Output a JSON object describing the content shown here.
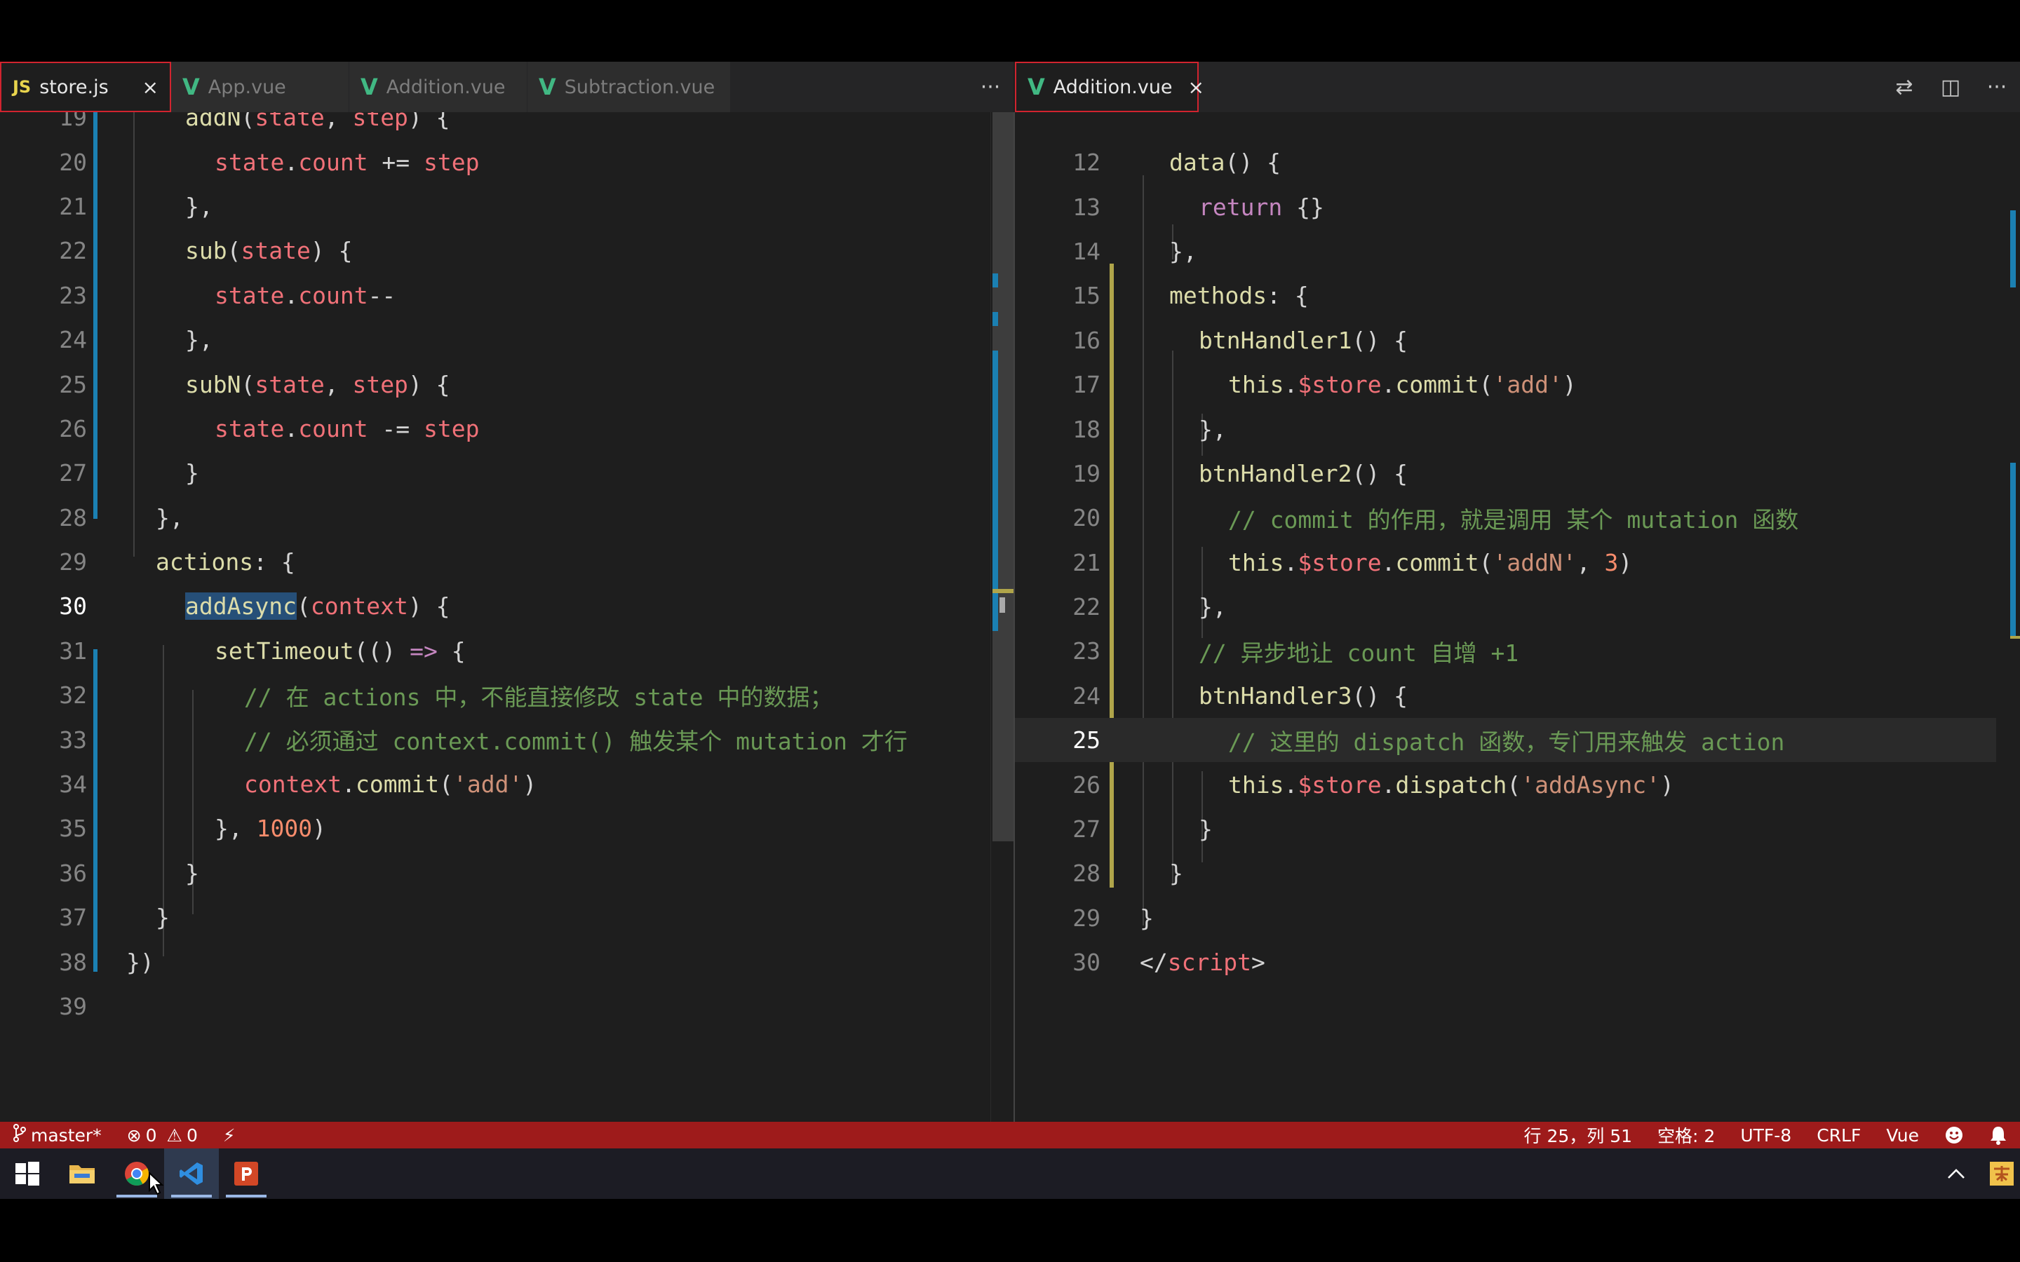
{
  "left_tabs": [
    {
      "icon": "js-file-icon",
      "badge": "JS",
      "label": "store.js",
      "active": true,
      "close": "×"
    },
    {
      "icon": "vue-file-icon",
      "badge": "V",
      "label": "App.vue",
      "active": false
    },
    {
      "icon": "vue-file-icon",
      "badge": "V",
      "label": "Addition.vue",
      "active": false
    },
    {
      "icon": "vue-file-icon",
      "badge": "V",
      "label": "Subtraction.vue",
      "active": false
    }
  ],
  "right_tabs": [
    {
      "icon": "vue-file-icon",
      "badge": "V",
      "label": "Addition.vue",
      "active": true,
      "close": "×"
    }
  ],
  "actions": {
    "more": "···",
    "compare": "⇄",
    "split": "◫"
  },
  "left_code": [
    {
      "n": "19",
      "indent": 2,
      "tokens": [
        [
          "func",
          "addN"
        ],
        [
          "punct",
          "("
        ],
        [
          "var",
          "state"
        ],
        [
          "punct",
          ", "
        ],
        [
          "var",
          "step"
        ],
        [
          "punct",
          ") {"
        ]
      ]
    },
    {
      "n": "20",
      "indent": 3,
      "tokens": [
        [
          "var",
          "state"
        ],
        [
          "punct",
          "."
        ],
        [
          "var",
          "count"
        ],
        [
          "punct",
          " += "
        ],
        [
          "var",
          "step"
        ]
      ]
    },
    {
      "n": "21",
      "indent": 2,
      "tokens": [
        [
          "punct",
          "},"
        ]
      ]
    },
    {
      "n": "22",
      "indent": 2,
      "tokens": [
        [
          "func",
          "sub"
        ],
        [
          "punct",
          "("
        ],
        [
          "var",
          "state"
        ],
        [
          "punct",
          ") {"
        ]
      ]
    },
    {
      "n": "23",
      "indent": 3,
      "tokens": [
        [
          "var",
          "state"
        ],
        [
          "punct",
          "."
        ],
        [
          "var",
          "count"
        ],
        [
          "punct",
          "--"
        ]
      ]
    },
    {
      "n": "24",
      "indent": 2,
      "tokens": [
        [
          "punct",
          "},"
        ]
      ]
    },
    {
      "n": "25",
      "indent": 2,
      "tokens": [
        [
          "func",
          "subN"
        ],
        [
          "punct",
          "("
        ],
        [
          "var",
          "state"
        ],
        [
          "punct",
          ", "
        ],
        [
          "var",
          "step"
        ],
        [
          "punct",
          ") {"
        ]
      ]
    },
    {
      "n": "26",
      "indent": 3,
      "tokens": [
        [
          "var",
          "state"
        ],
        [
          "punct",
          "."
        ],
        [
          "var",
          "count"
        ],
        [
          "punct",
          " -= "
        ],
        [
          "var",
          "step"
        ]
      ]
    },
    {
      "n": "27",
      "indent": 2,
      "tokens": [
        [
          "punct",
          "}"
        ]
      ]
    },
    {
      "n": "28",
      "indent": 1,
      "tokens": [
        [
          "punct",
          "},"
        ]
      ]
    },
    {
      "n": "29",
      "indent": 1,
      "tokens": [
        [
          "func",
          "actions"
        ],
        [
          "punct",
          ": {"
        ]
      ]
    },
    {
      "n": "30",
      "indent": 2,
      "current": true,
      "tokens": [
        [
          "sel",
          "addAsync"
        ],
        [
          "punct",
          "("
        ],
        [
          "var",
          "context"
        ],
        [
          "punct",
          ") {"
        ]
      ]
    },
    {
      "n": "31",
      "indent": 3,
      "tokens": [
        [
          "func",
          "setTimeout"
        ],
        [
          "punct",
          "(() "
        ],
        [
          "kw",
          "=>"
        ],
        [
          "punct",
          " {"
        ]
      ]
    },
    {
      "n": "32",
      "indent": 4,
      "tokens": [
        [
          "comment",
          "// 在 actions 中，不能直接修改 state 中的数据；"
        ]
      ]
    },
    {
      "n": "33",
      "indent": 4,
      "tokens": [
        [
          "comment",
          "// 必须通过 context.commit() 触发某个 mutation 才行"
        ]
      ]
    },
    {
      "n": "34",
      "indent": 4,
      "tokens": [
        [
          "var",
          "context"
        ],
        [
          "punct",
          "."
        ],
        [
          "func",
          "commit"
        ],
        [
          "punct",
          "("
        ],
        [
          "str",
          "'add'"
        ],
        [
          "punct",
          ")"
        ]
      ]
    },
    {
      "n": "35",
      "indent": 3,
      "tokens": [
        [
          "punct",
          "}, "
        ],
        [
          "num",
          "1000"
        ],
        [
          "punct",
          ")"
        ]
      ]
    },
    {
      "n": "36",
      "indent": 2,
      "tokens": [
        [
          "punct",
          "}"
        ]
      ]
    },
    {
      "n": "37",
      "indent": 1,
      "tokens": [
        [
          "punct",
          "}"
        ]
      ]
    },
    {
      "n": "38",
      "indent": 0,
      "tokens": [
        [
          "punct",
          "})"
        ]
      ]
    },
    {
      "n": "39",
      "indent": 0,
      "tokens": []
    }
  ],
  "right_code": [
    {
      "n": "12",
      "indent": 1,
      "tokens": [
        [
          "func",
          "data"
        ],
        [
          "punct",
          "() {"
        ]
      ]
    },
    {
      "n": "13",
      "indent": 2,
      "tokens": [
        [
          "kw",
          "return"
        ],
        [
          "punct",
          " {}"
        ]
      ]
    },
    {
      "n": "14",
      "indent": 1,
      "tokens": [
        [
          "punct",
          "},"
        ]
      ]
    },
    {
      "n": "15",
      "indent": 1,
      "tokens": [
        [
          "func",
          "methods"
        ],
        [
          "punct",
          ": {"
        ]
      ]
    },
    {
      "n": "16",
      "indent": 2,
      "tokens": [
        [
          "func",
          "btnHandler1"
        ],
        [
          "punct",
          "() {"
        ]
      ]
    },
    {
      "n": "17",
      "indent": 3,
      "tokens": [
        [
          "this",
          "this"
        ],
        [
          "punct",
          "."
        ],
        [
          "var",
          "$store"
        ],
        [
          "punct",
          "."
        ],
        [
          "func",
          "commit"
        ],
        [
          "punct",
          "("
        ],
        [
          "str",
          "'add'"
        ],
        [
          "punct",
          ")"
        ]
      ]
    },
    {
      "n": "18",
      "indent": 2,
      "tokens": [
        [
          "punct",
          "},"
        ]
      ]
    },
    {
      "n": "19",
      "indent": 2,
      "tokens": [
        [
          "func",
          "btnHandler2"
        ],
        [
          "punct",
          "() {"
        ]
      ]
    },
    {
      "n": "20",
      "indent": 3,
      "tokens": [
        [
          "comment",
          "// commit 的作用，就是调用 某个 mutation 函数"
        ]
      ]
    },
    {
      "n": "21",
      "indent": 3,
      "tokens": [
        [
          "this",
          "this"
        ],
        [
          "punct",
          "."
        ],
        [
          "var",
          "$store"
        ],
        [
          "punct",
          "."
        ],
        [
          "func",
          "commit"
        ],
        [
          "punct",
          "("
        ],
        [
          "str",
          "'addN'"
        ],
        [
          "punct",
          ", "
        ],
        [
          "num",
          "3"
        ],
        [
          "punct",
          ")"
        ]
      ]
    },
    {
      "n": "22",
      "indent": 2,
      "tokens": [
        [
          "punct",
          "},"
        ]
      ]
    },
    {
      "n": "23",
      "indent": 2,
      "tokens": [
        [
          "comment",
          "// 异步地让 count 自增 +1"
        ]
      ]
    },
    {
      "n": "24",
      "indent": 2,
      "tokens": [
        [
          "func",
          "btnHandler3"
        ],
        [
          "punct",
          "() {"
        ]
      ]
    },
    {
      "n": "25",
      "indent": 3,
      "current": true,
      "tokens": [
        [
          "comment",
          "// 这里的 dispatch 函数，专门用来触发 action"
        ]
      ]
    },
    {
      "n": "26",
      "indent": 3,
      "tokens": [
        [
          "this",
          "this"
        ],
        [
          "punct",
          "."
        ],
        [
          "var",
          "$store"
        ],
        [
          "punct",
          "."
        ],
        [
          "func",
          "dispatch"
        ],
        [
          "punct",
          "("
        ],
        [
          "str",
          "'addAsync'"
        ],
        [
          "punct",
          ")"
        ]
      ]
    },
    {
      "n": "27",
      "indent": 2,
      "tokens": [
        [
          "punct",
          "}"
        ]
      ]
    },
    {
      "n": "28",
      "indent": 1,
      "tokens": [
        [
          "punct",
          "}"
        ]
      ]
    },
    {
      "n": "29",
      "indent": 0,
      "tokens": [
        [
          "punct",
          "}"
        ]
      ]
    },
    {
      "n": "30",
      "indent": 0,
      "tokens": [
        [
          "punct",
          "</"
        ],
        [
          "tag",
          "script"
        ],
        [
          "punct",
          ">"
        ]
      ]
    }
  ],
  "status": {
    "branch": "master*",
    "errors": "0",
    "warnings": "0",
    "position": "行 25，列 51",
    "spaces": "空格: 2",
    "encoding": "UTF-8",
    "eol": "CRLF",
    "language": "Vue"
  },
  "colors": {
    "statusbar": "#9e1b1b",
    "tab_active_border": "#d1242f",
    "vue_green": "#41b883",
    "js_yellow": "#e8d44d",
    "git_modified": "#1b80b2",
    "git_added": "#b0a54a"
  }
}
